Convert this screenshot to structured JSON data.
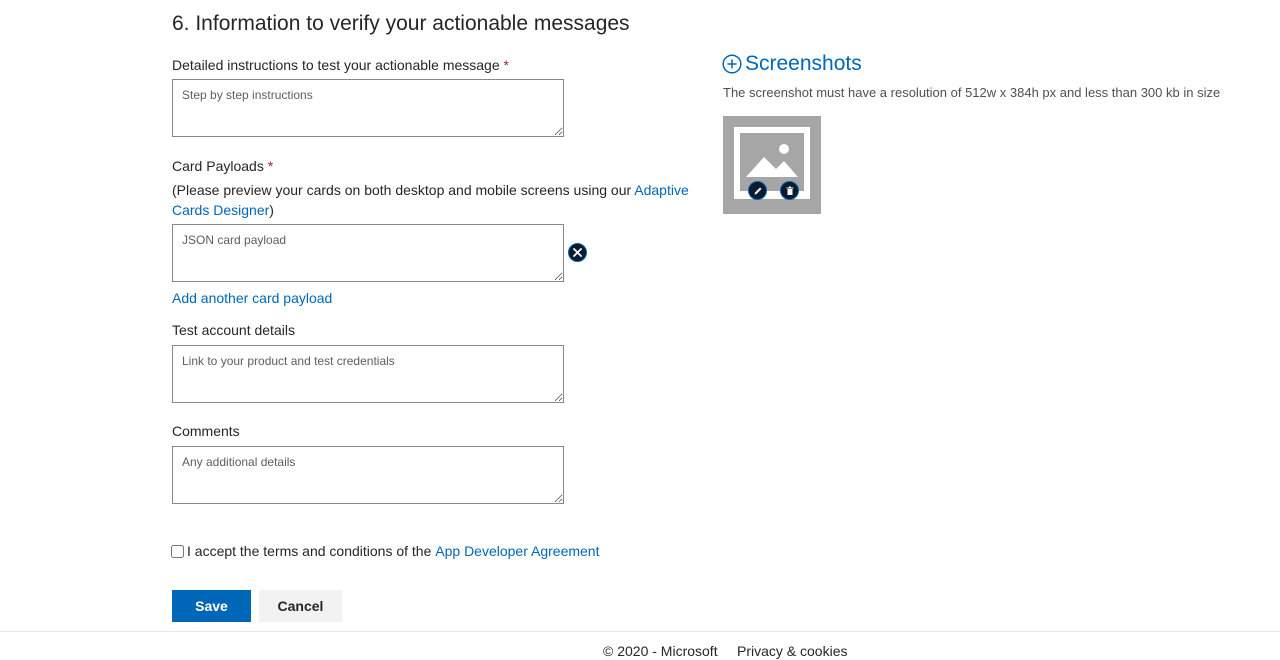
{
  "section": {
    "title": "6. Information to verify your actionable messages"
  },
  "fields": {
    "instructions": {
      "label": "Detailed instructions to test your actionable message",
      "required_marker": "*",
      "placeholder": "Step by step instructions",
      "value": ""
    },
    "payloads": {
      "label": "Card Payloads",
      "required_marker": "*",
      "helper_prefix": "(Please preview your cards on both desktop and mobile screens using our ",
      "helper_link": "Adaptive Cards Designer",
      "helper_suffix": ")",
      "placeholder": "JSON card payload",
      "value": "",
      "add_link": "Add another card payload"
    },
    "test_account": {
      "label": "Test account details",
      "placeholder": "Link to your product and test credentials",
      "value": ""
    },
    "comments": {
      "label": "Comments",
      "placeholder": "Any additional details",
      "value": ""
    }
  },
  "terms": {
    "checked": false,
    "text": "I accept the terms and conditions of the ",
    "link": "App Developer Agreement"
  },
  "buttons": {
    "save": "Save",
    "cancel": "Cancel"
  },
  "screenshots": {
    "title": "Screenshots",
    "note": "The screenshot must have a resolution of 512w x 384h px and less than 300 kb in size"
  },
  "footer": {
    "copyright": "© 2020 - Microsoft",
    "privacy": "Privacy & cookies"
  },
  "colors": {
    "accent": "#0067b8",
    "required": "#a4262c",
    "placeholder_gray": "#a6a6a6",
    "icon_dark": "#0b1a2e"
  },
  "icons": [
    "plus-circle-icon",
    "image-placeholder-icon",
    "edit-icon",
    "delete-icon",
    "remove-icon"
  ]
}
